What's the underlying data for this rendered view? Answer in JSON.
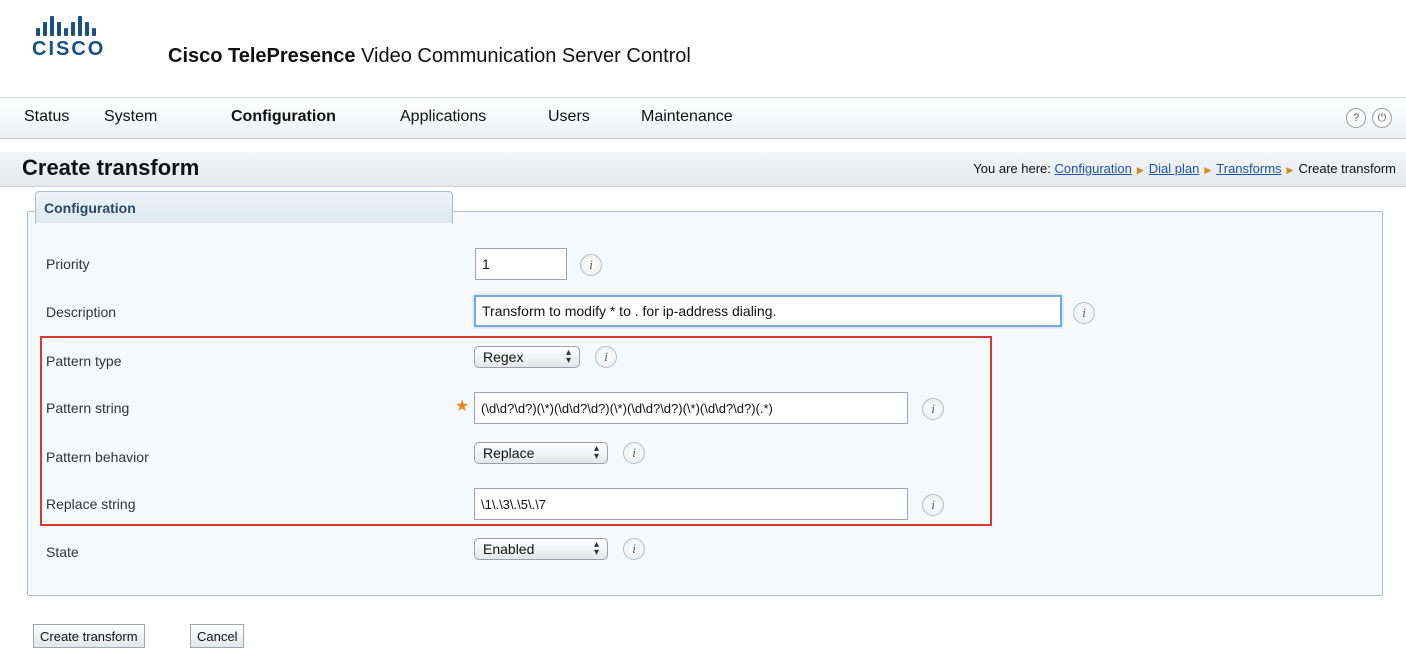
{
  "header": {
    "logo_text": "CISCO",
    "product_bold": "Cisco TelePresence",
    "product_rest": " Video Communication Server Control"
  },
  "nav": {
    "items": [
      {
        "label": "Status"
      },
      {
        "label": "System"
      },
      {
        "label": "Configuration",
        "active": true
      },
      {
        "label": "Applications"
      },
      {
        "label": "Users"
      },
      {
        "label": "Maintenance"
      }
    ],
    "icons": [
      "help-icon",
      "logout-icon"
    ],
    "help_glyph": "?",
    "logout_glyph": "⏻"
  },
  "page": {
    "title": "Create transform",
    "breadcrumb_prefix": "You are here:",
    "breadcrumb": [
      "Configuration",
      "Dial plan",
      "Transforms"
    ],
    "breadcrumb_current": "Create transform"
  },
  "section": {
    "title": "Configuration"
  },
  "form": {
    "priority": {
      "label": "Priority",
      "value": "1"
    },
    "description": {
      "label": "Description",
      "value": "Transform to modify * to . for ip-address dialing."
    },
    "pattern_type": {
      "label": "Pattern type",
      "value": "Regex"
    },
    "pattern_string": {
      "label": "Pattern string",
      "value": "(\\d\\d?\\d?)(\\*)(\\d\\d?\\d?)(\\*)(\\d\\d?\\d?)(\\*)(\\d\\d?\\d?)(.*)"
    },
    "pattern_behavior": {
      "label": "Pattern behavior",
      "value": "Replace"
    },
    "replace_string": {
      "label": "Replace string",
      "value": "\\1\\.\\3\\.\\5\\.\\7"
    },
    "state": {
      "label": "State",
      "value": "Enabled"
    },
    "info_glyph": "i",
    "required_glyph": "★"
  },
  "buttons": {
    "create": "Create transform",
    "cancel": "Cancel"
  },
  "colors": {
    "brand": "#1a4f86",
    "link": "#1a58a6",
    "highlight": "#d43a2f",
    "required": "#e48a1a"
  }
}
